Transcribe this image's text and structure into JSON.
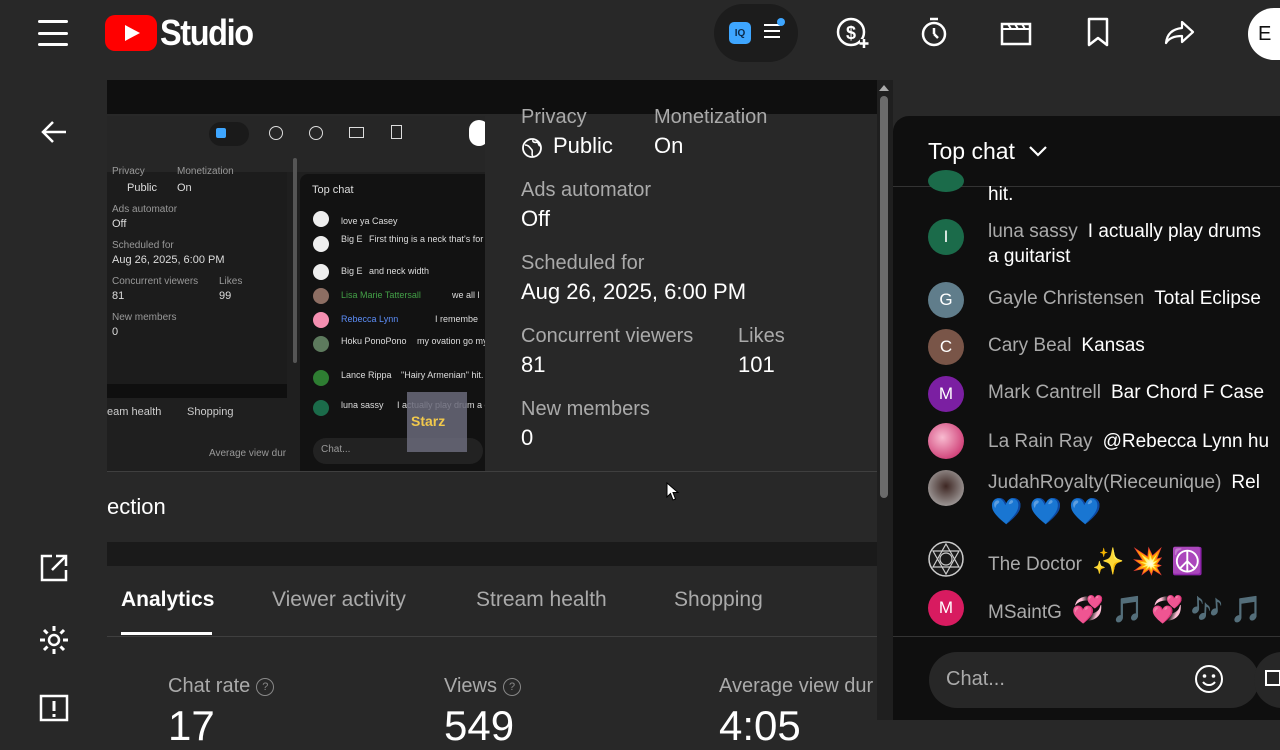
{
  "topbar": {
    "app_name": "Studio",
    "iq_badge": "IQ",
    "avatar_letter": "E",
    "icons": [
      "menu-icon",
      "youtube-logo-icon",
      "monetization-icon",
      "timer-icon",
      "clapperboard-icon",
      "bookmark-icon",
      "share-icon"
    ]
  },
  "thumbnail": {
    "privacy_label": "Privacy",
    "privacy_value": "Public",
    "monetization_label": "Monetization",
    "monetization_value": "On",
    "ads_label": "Ads automator",
    "ads_value": "Off",
    "scheduled_label": "Scheduled for",
    "scheduled_value": "Aug 26, 2025, 6:00 PM",
    "viewers_label": "Concurrent viewers",
    "viewers_value": "81",
    "likes_label": "Likes",
    "likes_value": "99",
    "members_label": "New members",
    "members_value": "0",
    "tab_stream": "eam health",
    "tab_shopping": "Shopping",
    "avg_label": "Average view dur",
    "chat_header": "Top chat",
    "chat_placeholder": "Chat...",
    "chat_lines": [
      {
        "author": "",
        "text": "love ya Casey"
      },
      {
        "author": "Big E",
        "text": "First thing is a neck that's for that particular individual"
      },
      {
        "author": "Big E",
        "text": "and neck width"
      },
      {
        "author": "Lisa Marie Tattersall",
        "text": "we all l"
      },
      {
        "author": "Rebecca Lynn",
        "text": "I remembe"
      },
      {
        "author": "Hoku PonoPono",
        "text": "my ovation go my permission.."
      },
      {
        "author": "Lance Rippa",
        "text": "\"Hairy Armenian\" hit."
      },
      {
        "author": "luna sassy",
        "text": "I actually play drum a guitarist"
      }
    ],
    "sticker_text": "Starz"
  },
  "details": {
    "privacy_label": "Privacy",
    "privacy_value": "Public",
    "monetization_label": "Monetization",
    "monetization_value": "On",
    "ads_label": "Ads automator",
    "ads_value": "Off",
    "scheduled_label": "Scheduled for",
    "scheduled_value": "Aug 26, 2025, 6:00 PM",
    "viewers_label": "Concurrent viewers",
    "viewers_value": "81",
    "likes_label": "Likes",
    "likes_value": "101",
    "members_label": "New members",
    "members_value": "0"
  },
  "section_title": "ection",
  "tabs": [
    "Analytics",
    "Viewer activity",
    "Stream health",
    "Shopping"
  ],
  "stats": {
    "chat_rate_label": "Chat rate",
    "chat_rate_value": "17",
    "views_label": "Views",
    "views_value": "549",
    "avg_label": "Average view dur",
    "avg_value": "4:05"
  },
  "chat": {
    "header": "Top chat",
    "placeholder": "Chat...",
    "messages": [
      {
        "author": "",
        "text": "hit.",
        "avatar": ""
      },
      {
        "author": "luna sassy",
        "text": "I actually play drums",
        "text2": "a guitarist",
        "avatar": "I",
        "color": "#1b6b4a"
      },
      {
        "author": "Gayle Christensen",
        "text": "Total Eclipse",
        "avatar": "G",
        "color": "#607d8b"
      },
      {
        "author": "Cary Beal",
        "text": "Kansas",
        "avatar": "C",
        "color": "#795548"
      },
      {
        "author": "Mark Cantrell",
        "text": "Bar Chord F Case",
        "avatar": "M",
        "color": "#7b1fa2"
      },
      {
        "author": "La Rain Ray",
        "text": "@Rebecca Lynn hu",
        "avatar": "",
        "color": "#c2185b"
      },
      {
        "author": "JudahRoyalty(Rieceunique)",
        "text": "Rel",
        "text2": "💙 💙 💙",
        "avatar": "",
        "color": "#5d4037"
      },
      {
        "author": "The Doctor",
        "text": "✨ 💥 ☮️",
        "avatar": "",
        "color": "#333333"
      },
      {
        "author": "MSaintG",
        "text": "💞 🎵 💞 🎶 🎵",
        "avatar": "M",
        "color": "#d81b60"
      }
    ]
  }
}
